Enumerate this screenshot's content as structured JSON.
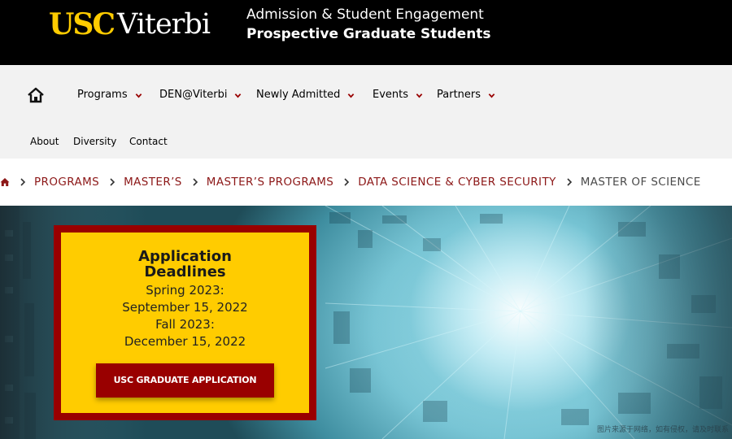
{
  "header": {
    "logo_usc": "USC",
    "logo_viterbi": "Viterbi",
    "department": "Admission & Student Engagement",
    "audience": "Prospective Graduate Students"
  },
  "main_nav": {
    "home_icon": "home-icon",
    "items": [
      {
        "label": "Programs"
      },
      {
        "label": "DEN@Viterbi"
      },
      {
        "label": "Newly Admitted"
      },
      {
        "label": "Events"
      },
      {
        "label": "Partners"
      }
    ]
  },
  "sub_nav": {
    "items": [
      {
        "label": "About"
      },
      {
        "label": "Diversity"
      },
      {
        "label": "Contact"
      }
    ]
  },
  "breadcrumb": {
    "home_icon": "home-icon",
    "items": [
      {
        "label": "PROGRAMS"
      },
      {
        "label": "MASTER’S"
      },
      {
        "label": "MASTER’S PROGRAMS"
      },
      {
        "label": "DATA SCIENCE & CYBER SECURITY"
      }
    ],
    "current": "MASTER OF SCIENCE"
  },
  "deadlines": {
    "title": "Application Deadlines",
    "spring_label": "Spring 2023:",
    "spring_date": "September 15, 2022",
    "fall_label": "Fall 2023:",
    "fall_date": "December 15, 2022",
    "apply_button": "USC GRADUATE APPLICATION"
  },
  "watermark": "图片来源于网络，如有侵权，请及时联系",
  "colors": {
    "cardinal": "#990000",
    "gold": "#ffcc00",
    "header_bg": "#000000",
    "nav_bg": "#f2f2f2",
    "breadcrumb_link": "#8c1717"
  }
}
